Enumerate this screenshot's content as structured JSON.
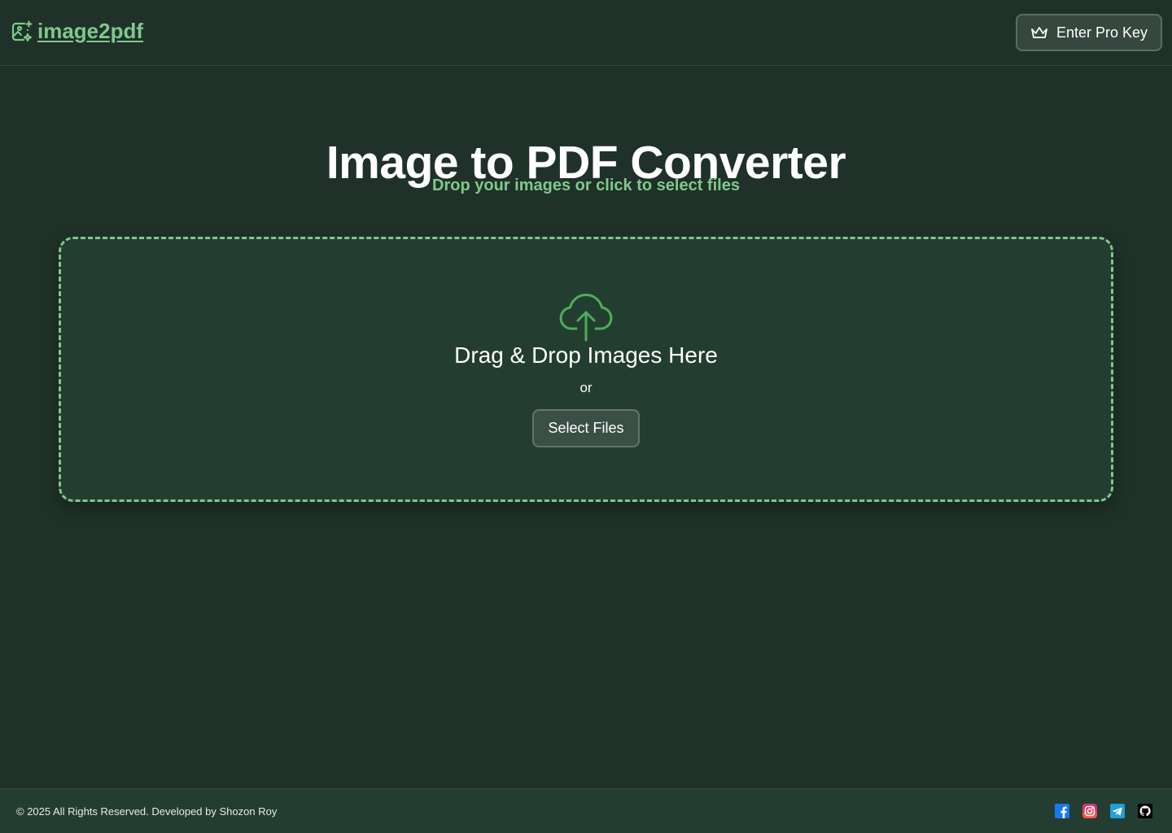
{
  "header": {
    "logo_text": "image2pdf",
    "logo_icon": "image-sparkle-icon",
    "pro_button_label": "Enter Pro Key",
    "pro_button_icon": "crown-icon"
  },
  "main": {
    "title": "Image to PDF Converter",
    "subtitle": "Drop your images or click to select files"
  },
  "dropzone": {
    "icon": "cloud-upload-icon",
    "title": "Drag & Drop Images Here",
    "or_text": "or",
    "select_button_label": "Select Files"
  },
  "footer": {
    "copyright": "© 2025 All Rights Reserved. Developed by Shozon Roy",
    "socials": [
      {
        "icon": "facebook-icon",
        "color": "#1877f2"
      },
      {
        "icon": "instagram-icon",
        "color": "#e1306c"
      },
      {
        "icon": "telegram-icon",
        "color": "#229ed9"
      },
      {
        "icon": "github-icon",
        "color": "#000000"
      }
    ]
  },
  "colors": {
    "background": "#1f3129",
    "accent": "#7fc98a",
    "dropzone_bg": "#243d31",
    "icon_green": "#4caf58"
  }
}
